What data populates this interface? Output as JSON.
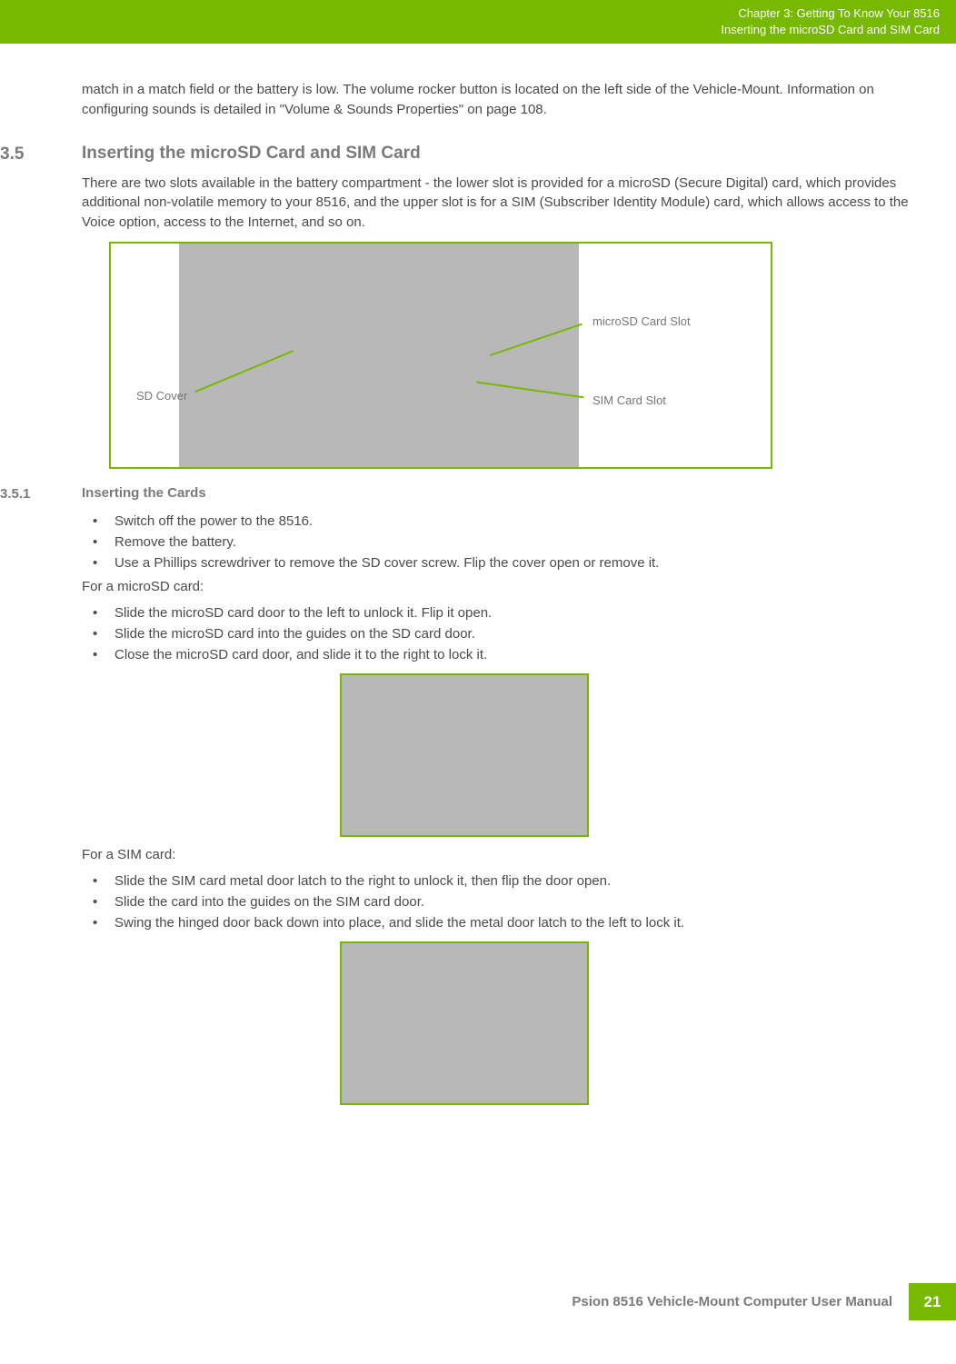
{
  "header": {
    "line1": "Chapter 3:  Getting To Know Your 8516",
    "line2": "Inserting the microSD Card and SIM Card"
  },
  "intro_continuation": "match in a match field or the battery is low. The volume rocker button is located on the left side of the Vehicle-Mount. Information on configuring sounds is detailed in \"Volume & Sounds Properties\" on page 108.",
  "section35": {
    "num": "3.5",
    "title": "Inserting the microSD Card and SIM Card",
    "para": "There are two slots available in the battery compartment - the lower slot is provided for a microSD (Secure Digital) card, which provides additional non-volatile memory to your 8516, and the upper slot is for a SIM (Subscriber Identity Module) card, which allows access to the Voice option, access to the Internet, and so on."
  },
  "figure1": {
    "label_sd_cover": "SD Cover",
    "label_microsd_slot": "microSD Card Slot",
    "label_sim_slot": "SIM Card Slot"
  },
  "section351": {
    "num": "3.5.1",
    "title": "Inserting the Cards",
    "bullets_a": [
      "Switch off the power to the 8516.",
      "Remove the battery.",
      "Use a Phillips screwdriver to remove the SD cover screw. Flip the cover open or remove it."
    ],
    "line_microsd": "For a microSD card:",
    "bullets_b": [
      "Slide the microSD card door to the left to unlock it. Flip it open.",
      "Slide the microSD card into the guides on the SD card door.",
      "Close the microSD card door, and slide it to the right to lock it."
    ],
    "line_sim": "For a SIM card:",
    "bullets_c": [
      "Slide the SIM card metal door latch to the right to unlock it, then flip the door open.",
      "Slide the card into the guides on the SIM card door.",
      "Swing the hinged door back down into place, and slide the metal door latch to the left to lock it."
    ]
  },
  "footer": {
    "manual_title": "Psion 8516 Vehicle-Mount Computer User Manual",
    "page_number": "21"
  }
}
